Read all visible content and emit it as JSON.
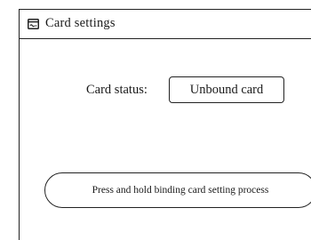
{
  "header": {
    "icon": "card-icon",
    "title": "Card settings"
  },
  "card_status": {
    "label": "Card status:",
    "value": "Unbound card"
  },
  "bind_button": {
    "label": "Press and hold binding card setting process"
  }
}
